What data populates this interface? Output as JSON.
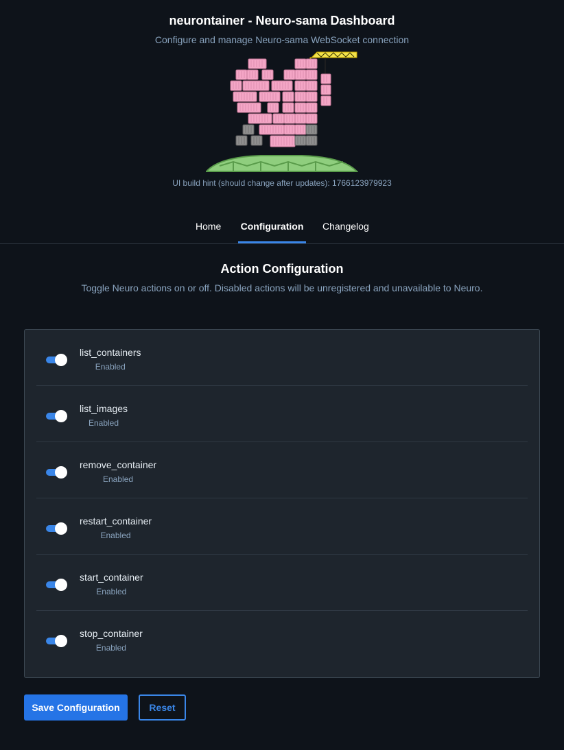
{
  "header": {
    "title": "neurontainer - Neuro-sama Dashboard",
    "subtitle": "Configure and manage Neuro-sama WebSocket connection",
    "build_hint": "UI build hint (should change after updates): 1766123979923"
  },
  "tabs": [
    {
      "label": "Home",
      "active": false
    },
    {
      "label": "Configuration",
      "active": true
    },
    {
      "label": "Changelog",
      "active": false
    }
  ],
  "section": {
    "title": "Action Configuration",
    "description": "Toggle Neuro actions on or off. Disabled actions will be unregistered and unavailable to Neuro."
  },
  "actions": [
    {
      "name": "list_containers",
      "status": "Enabled",
      "enabled": true
    },
    {
      "name": "list_images",
      "status": "Enabled",
      "enabled": true
    },
    {
      "name": "remove_container",
      "status": "Enabled",
      "enabled": true
    },
    {
      "name": "restart_container",
      "status": "Enabled",
      "enabled": true
    },
    {
      "name": "start_container",
      "status": "Enabled",
      "enabled": true
    },
    {
      "name": "stop_container",
      "status": "Enabled",
      "enabled": true
    }
  ],
  "buttons": {
    "save_label": "Save Configuration",
    "reset_label": "Reset"
  },
  "colors": {
    "background": "#0e131a",
    "panel": "#1e252d",
    "accent": "#2574e6",
    "toggle_on": "#3a86e8",
    "container_pink": "#f4a6c6",
    "container_gray": "#8f8f8f",
    "turtle_shell": "#8fce7e",
    "crane": "#f2e34b"
  },
  "icons": {
    "logo": "neurontainer-logo-container-stack-on-turtle-with-crane"
  }
}
